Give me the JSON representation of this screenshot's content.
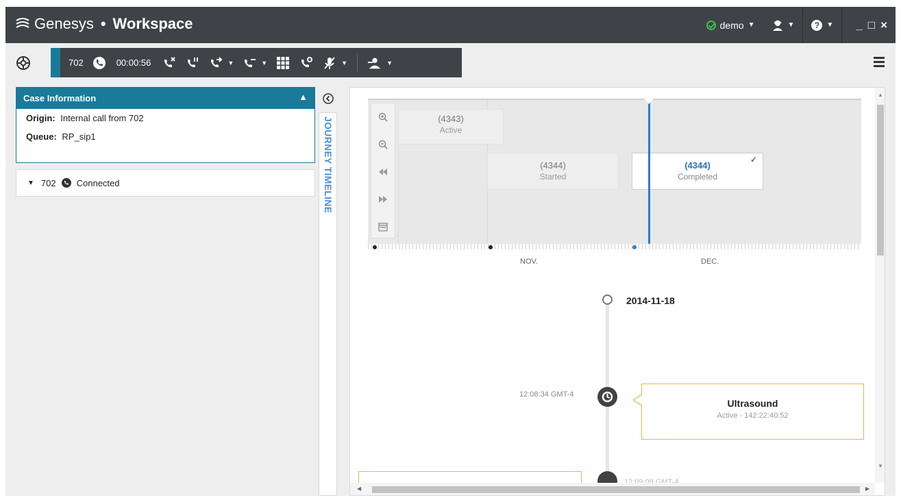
{
  "titlebar": {
    "brand_name": "Genesys",
    "separator": "•",
    "app_name": "Workspace",
    "user": "demo",
    "help_icon": "?",
    "minimize": "_",
    "maximize": "□",
    "close": "×"
  },
  "callbar": {
    "party": "702",
    "timer": "00:00:56"
  },
  "case_panel": {
    "title": "Case Information",
    "origin_label": "Origin:",
    "origin_value": "Internal call from 702",
    "queue_label": "Queue:",
    "queue_value": "RP_sip1"
  },
  "call_item": {
    "party": "702",
    "status": "Connected"
  },
  "journey_tab": {
    "label": "JOURNEY TIMELINE"
  },
  "timeline": {
    "cards": [
      {
        "id": "(4343)",
        "state": "Active"
      },
      {
        "id": "(4344)",
        "state": "Started"
      },
      {
        "id": "(4344)",
        "state": "Completed"
      }
    ],
    "months": [
      "NOV.",
      "DEC."
    ],
    "date": "2014-11-18",
    "event": {
      "time": "12:08:34 GMT-4",
      "title": "Ultrasound",
      "subtitle": "Active - 142:22:40:52"
    },
    "partial_time": "12:09:09 GMT-4"
  },
  "colors": {
    "titlebar": "#3f4347",
    "accent": "#1a7a9a",
    "timeline_blue": "#2a7bd4",
    "event_border": "#f0b24a",
    "status_green": "#37c24a"
  }
}
